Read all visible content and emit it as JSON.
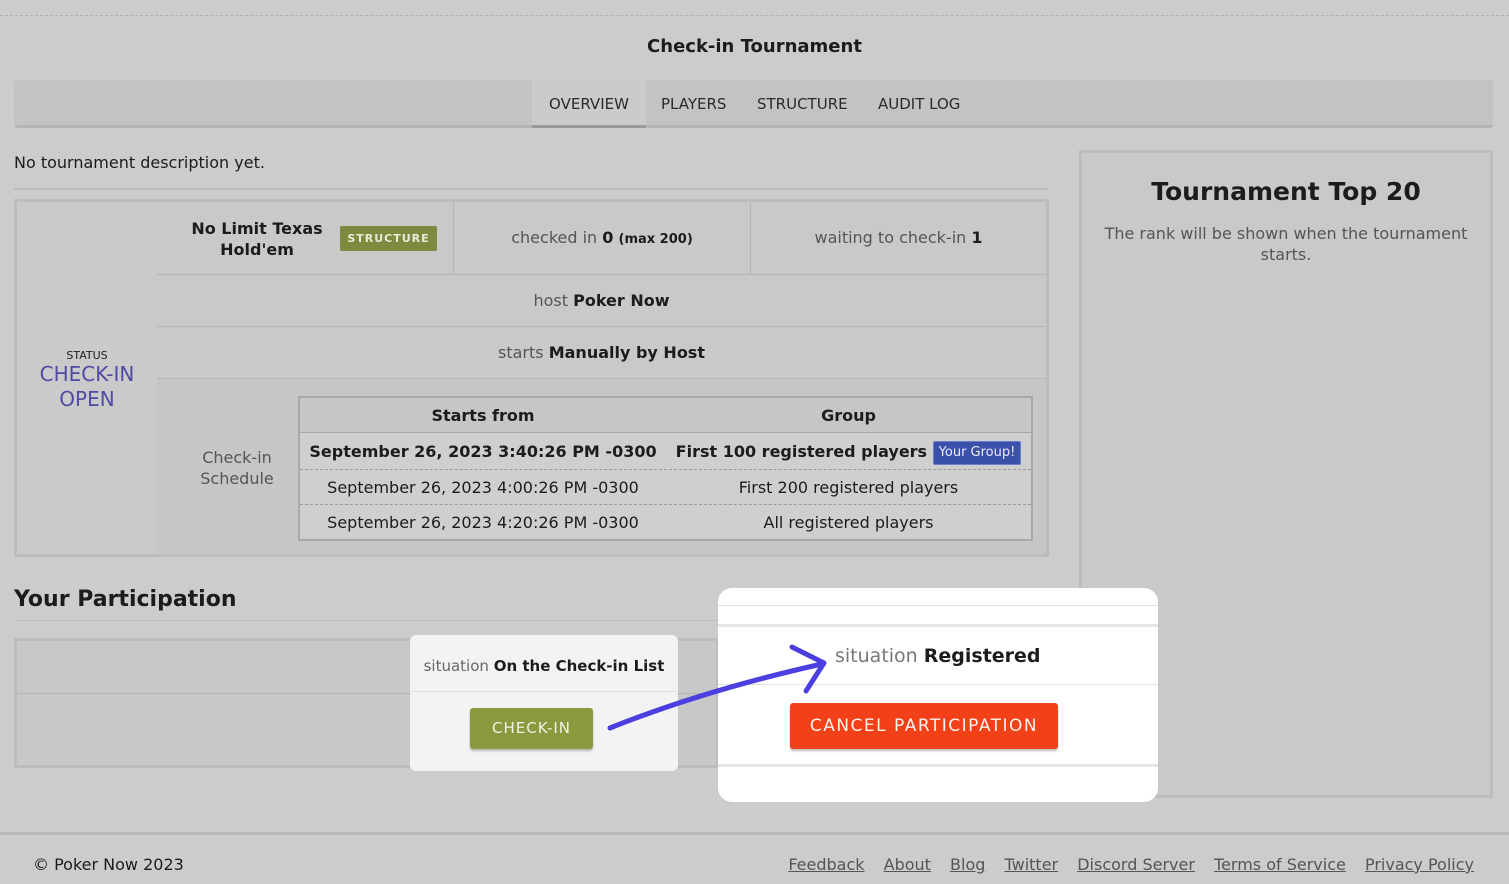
{
  "page": {
    "title": "Check-in Tournament"
  },
  "tabs": [
    {
      "label": "OVERVIEW",
      "active": true
    },
    {
      "label": "PLAYERS"
    },
    {
      "label": "STRUCTURE"
    },
    {
      "label": "AUDIT LOG"
    }
  ],
  "overview": {
    "description": "No tournament description yet.",
    "status": {
      "label": "STATUS",
      "value_line1": "CHECK-IN",
      "value_line2": "OPEN"
    },
    "game": {
      "line1": "No Limit Texas",
      "line2": "Hold'em",
      "badge": "STRUCTURE"
    },
    "checked_in": {
      "prefix": "checked in",
      "count": "0",
      "max": "(max 200)"
    },
    "waiting": {
      "prefix": "waiting to check-in",
      "count": "1"
    },
    "host": {
      "prefix": "host",
      "value": "Poker Now"
    },
    "starts": {
      "prefix": "starts",
      "value": "Manually by Host"
    },
    "schedule": {
      "label_line1": "Check-in",
      "label_line2": "Schedule",
      "headers": [
        "Starts from",
        "Group"
      ],
      "rows": [
        {
          "starts": "September 26, 2023 3:40:26 PM -0300",
          "group": "First 100 registered players",
          "badge": "Your Group!"
        },
        {
          "starts": "September 26, 2023 4:00:26 PM -0300",
          "group": "First 200 registered players"
        },
        {
          "starts": "September 26, 2023 4:20:26 PM -0300",
          "group": "All registered players"
        }
      ]
    }
  },
  "top20": {
    "title": "Tournament Top 20",
    "text": "The rank will be shown when the tournament starts."
  },
  "participation": {
    "title": "Your Participation",
    "before": {
      "prefix": "situation",
      "value": "On the Check-in List",
      "button": "CHECK-IN"
    },
    "after": {
      "prefix": "situation",
      "value": "Registered",
      "button": "CANCEL PARTICIPATION"
    }
  },
  "colors": {
    "arrow": "#4b3fe0",
    "check_in_button": "#8a9a3e",
    "cancel_button": "#f24018",
    "status": "#4f4aa6"
  },
  "footer": {
    "copyright": "© Poker Now 2023",
    "links": [
      "Feedback",
      "About",
      "Blog",
      "Twitter",
      "Discord Server",
      "Terms of Service",
      "Privacy Policy"
    ]
  }
}
